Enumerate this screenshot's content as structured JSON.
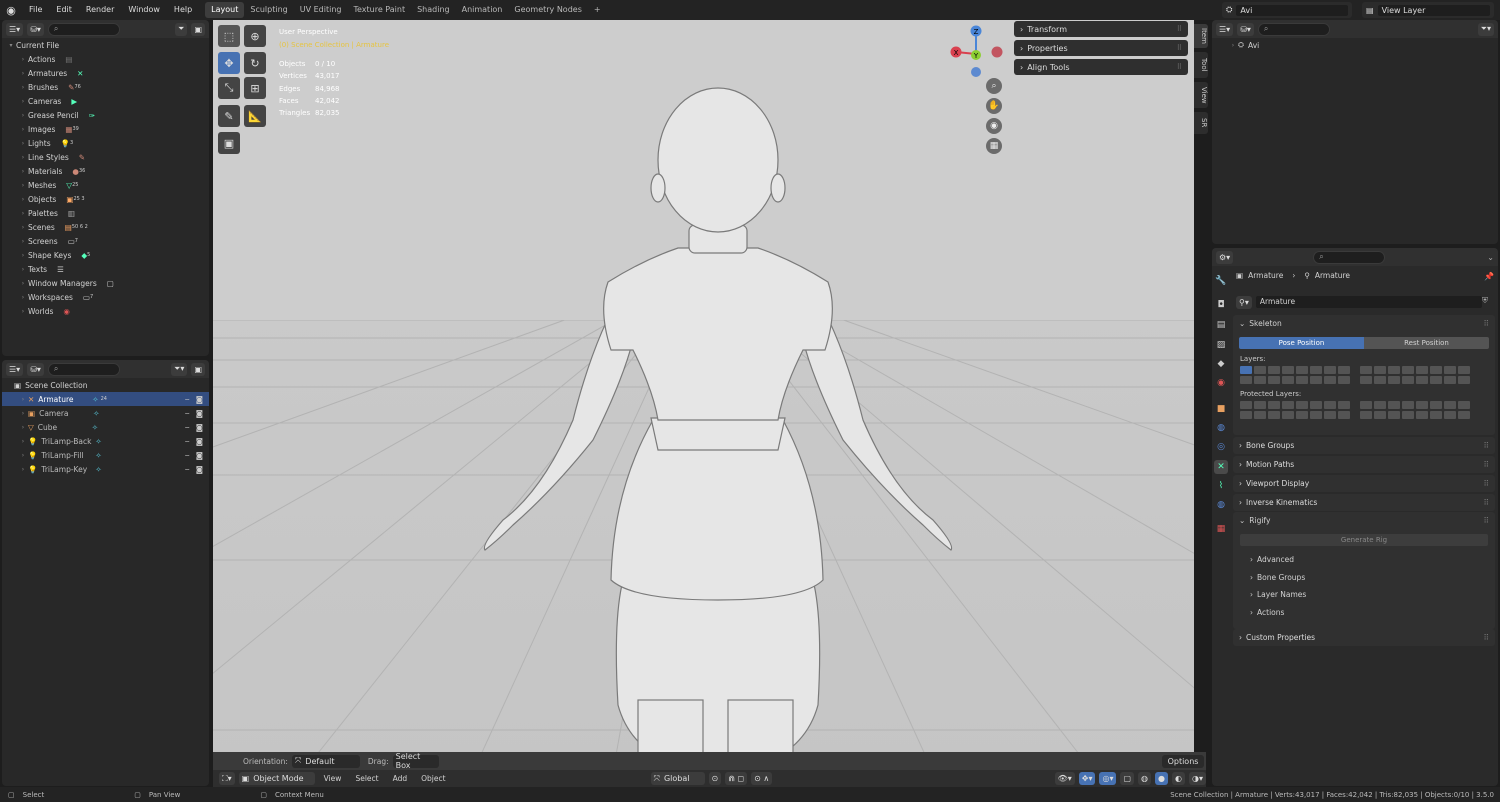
{
  "menubar": {
    "items": [
      "File",
      "Edit",
      "Render",
      "Window",
      "Help"
    ]
  },
  "workspaces": [
    "Layout",
    "Sculpting",
    "UV Editing",
    "Texture Paint",
    "Shading",
    "Animation",
    "Geometry Nodes",
    "+"
  ],
  "topright": {
    "scene": "Avi",
    "view_layer": "View Layer"
  },
  "outliner_data": {
    "root": "Current File",
    "rows": [
      {
        "label": "Actions",
        "count": ""
      },
      {
        "label": "Armatures",
        "count": ""
      },
      {
        "label": "Brushes",
        "count": "76"
      },
      {
        "label": "Cameras",
        "count": ""
      },
      {
        "label": "Grease Pencil",
        "count": ""
      },
      {
        "label": "Images",
        "count": "39"
      },
      {
        "label": "Lights",
        "count": "3"
      },
      {
        "label": "Line Styles",
        "count": ""
      },
      {
        "label": "Materials",
        "count": "36"
      },
      {
        "label": "Meshes",
        "count": "25"
      },
      {
        "label": "Objects",
        "count": "25 3"
      },
      {
        "label": "Palettes",
        "count": ""
      },
      {
        "label": "Scenes",
        "count": "50 6 2"
      },
      {
        "label": "Screens",
        "count": "7"
      },
      {
        "label": "Shape Keys",
        "count": "5"
      },
      {
        "label": "Texts",
        "count": ""
      },
      {
        "label": "Window Managers",
        "count": ""
      },
      {
        "label": "Workspaces",
        "count": "7"
      },
      {
        "label": "Worlds",
        "count": ""
      }
    ]
  },
  "scene_outliner": {
    "root": "Scene Collection",
    "rows": [
      {
        "label": "Armature",
        "extra": "24",
        "selected": true
      },
      {
        "label": "Camera",
        "extra": "",
        "selected": false
      },
      {
        "label": "Cube",
        "extra": "",
        "selected": false
      },
      {
        "label": "TriLamp-Back",
        "extra": "",
        "selected": false
      },
      {
        "label": "TriLamp-Fill",
        "extra": "",
        "selected": false
      },
      {
        "label": "TriLamp-Key",
        "extra": "",
        "selected": false
      }
    ]
  },
  "viewport": {
    "title": "User Perspective",
    "collection": "(0) Scene Collection | Armature",
    "stats": [
      {
        "label": "Objects",
        "value": "0 / 10"
      },
      {
        "label": "Vertices",
        "value": "43,017"
      },
      {
        "label": "Edges",
        "value": "84,968"
      },
      {
        "label": "Faces",
        "value": "42,042"
      },
      {
        "label": "Triangles",
        "value": "82,035"
      }
    ],
    "npanel": [
      "Transform",
      "Properties",
      "Align Tools"
    ],
    "sidetabs": [
      "Item",
      "Tool",
      "View",
      "SR"
    ],
    "gizmo": {
      "z": "Z",
      "y": "Y",
      "x": "X"
    }
  },
  "tool_settings": {
    "orientation_label": "Orientation:",
    "orientation_value": "Default",
    "drag_label": "Drag:",
    "drag_value": "Select Box",
    "options": "Options"
  },
  "viewport_header": {
    "mode": "Object Mode",
    "menus": [
      "View",
      "Select",
      "Add",
      "Object"
    ],
    "transform": "Global"
  },
  "properties": {
    "breadcrumb": [
      "Armature",
      "Armature"
    ],
    "datablock": "Armature",
    "skeleton": "Skeleton",
    "pose_position": "Pose Position",
    "rest_position": "Rest Position",
    "layers": "Layers:",
    "protected_layers": "Protected Layers:",
    "sections": [
      "Bone Groups",
      "Motion Paths",
      "Viewport Display",
      "Inverse Kinematics"
    ],
    "rigify": "Rigify",
    "generate_rig": "Generate Rig",
    "rigify_subs": [
      "Advanced",
      "Bone Groups",
      "Layer Names",
      "Actions"
    ],
    "custom_properties": "Custom Properties"
  },
  "top_right_outliner": {
    "item": "Avi"
  },
  "status": {
    "select": "Select",
    "pan": "Pan View",
    "context": "Context Menu",
    "info": "Scene Collection | Armature | Verts:43,017 | Faces:42,042 | Tris:82,035 | Objects:0/10 | 3.5.0"
  },
  "colors": {
    "accent": "#4772b3",
    "highlight_row": "#334d80"
  }
}
